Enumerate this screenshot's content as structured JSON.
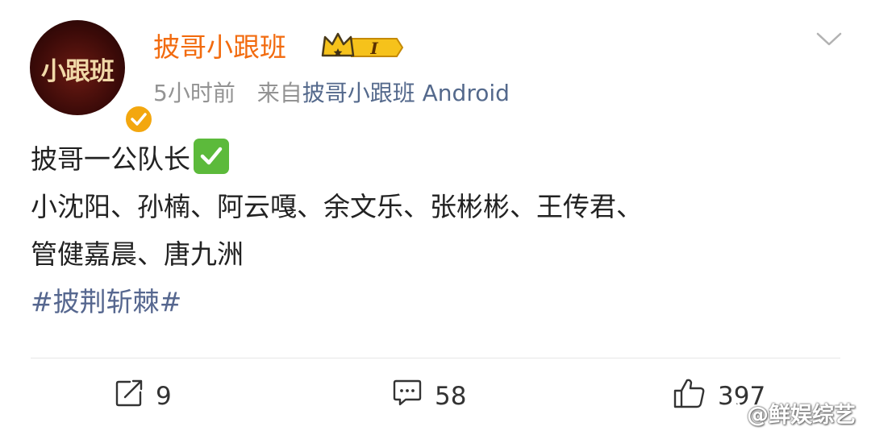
{
  "post": {
    "avatar_text": "小跟班",
    "username": "披哥小跟班",
    "member_level": "I",
    "time": "5小时前",
    "source_prefix": "来自",
    "source": "披哥小跟班 Android",
    "lines": [
      "披哥一公队长",
      "小沈阳、孙楠、阿云嘎、余文乐、张彬彬、王传君、",
      "管健嘉晨、唐九洲"
    ],
    "hashtag": "#披荆斩棘#"
  },
  "actions": {
    "repost_count": "9",
    "comment_count": "58",
    "like_count": "397"
  },
  "watermark": "@鲜娱综艺",
  "colors": {
    "username": "#f26b0f",
    "link": "#54698c",
    "meta": "#939393",
    "verify_badge": "#f3a70f",
    "check_emoji": "#5cba3b"
  },
  "icons": [
    "verified-icon",
    "crown-member-icon",
    "chevron-down-icon",
    "check-mark-icon",
    "repost-icon",
    "comment-icon",
    "like-icon",
    "weibo-logo-icon"
  ]
}
